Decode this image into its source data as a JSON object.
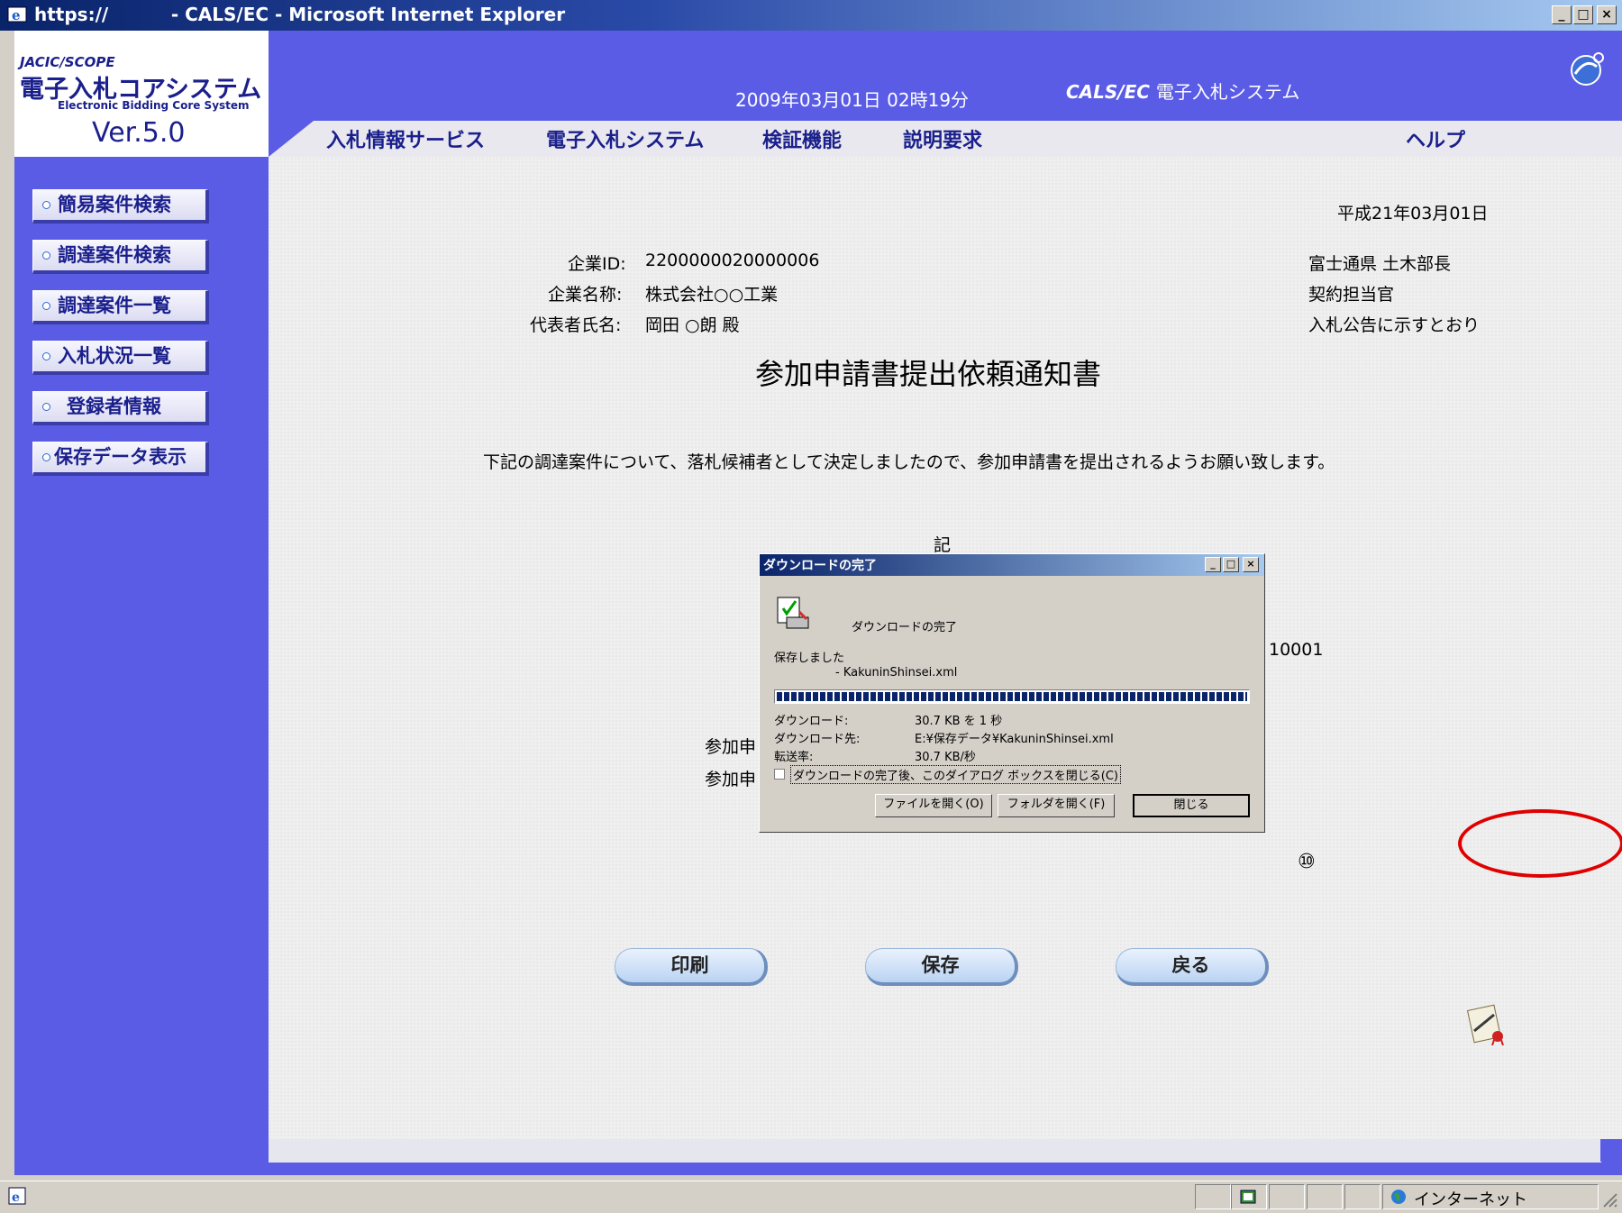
{
  "window": {
    "title": "https://          - CALS/EC - Microsoft Internet Explorer",
    "min_label": "_",
    "max_label": "□",
    "close_label": "×"
  },
  "logo": {
    "line1": "JACIC/SCOPE",
    "line2": "電子入札コアシステム",
    "line3": "Electronic Bidding Core System",
    "version": "Ver.5.0"
  },
  "header": {
    "datetime": "2009年03月01日 02時19分",
    "system_prefix": "CALS/EC",
    "system_name": "電子入札システム"
  },
  "menu": [
    "入札情報サービス",
    "電子入札システム",
    "検証機能",
    "説明要求",
    "ヘルプ"
  ],
  "sidebar": {
    "items": [
      {
        "label": "簡易案件検索"
      },
      {
        "label": "調達案件検索"
      },
      {
        "label": "調達案件一覧"
      },
      {
        "label": "入札状況一覧"
      },
      {
        "label": "登録者情報"
      },
      {
        "label": "保存データ表示"
      }
    ]
  },
  "document": {
    "date": "平成21年03月01日",
    "company_id_label": "企業ID:",
    "company_id": "2200000020000006",
    "company_name_label": "企業名称:",
    "company_name": "株式会社○○工業",
    "rep_label": "代表者氏名:",
    "rep_name": "岡田 ○朗 殿",
    "recipient1": "富士通県 土木部長",
    "recipient2": "契約担当官",
    "recipient3": "入札公告に示すとおり",
    "title": "参加申請書提出依頼通知書",
    "body": "下記の調達案件について、落札候補者として決定しましたので、参加申請書を提出されるようお願い致します。",
    "ki": "記",
    "partial_number": "10001",
    "partial_label1": "参加申",
    "partial_label2": "参加申",
    "circled_marker": "⑩"
  },
  "buttons": {
    "print": "印刷",
    "save": "保存",
    "back": "戻る"
  },
  "dialog": {
    "title": "ダウンロードの完了",
    "heading": "ダウンロードの完了",
    "saved": "保存しました",
    "filename": "- KakuninShinsei.xml",
    "progress": 1.0,
    "download_label": "ダウンロード:",
    "download_value": "30.7 KB を 1 秒",
    "dest_label": "ダウンロード先:",
    "dest_value": "E:¥保存データ¥KakuninShinsei.xml",
    "rate_label": "転送率:",
    "rate_value": "30.7 KB/秒",
    "checkbox_label": "ダウンロードの完了後、このダイアログ ボックスを閉じる(C)",
    "open_file": "ファイルを開く(O)",
    "open_folder": "フォルダを開く(F)",
    "close": "閉じる"
  },
  "statusbar": {
    "zone": "インターネット"
  },
  "colors": {
    "sidebar": "#5a5ce6",
    "annotation": "#e00000"
  }
}
